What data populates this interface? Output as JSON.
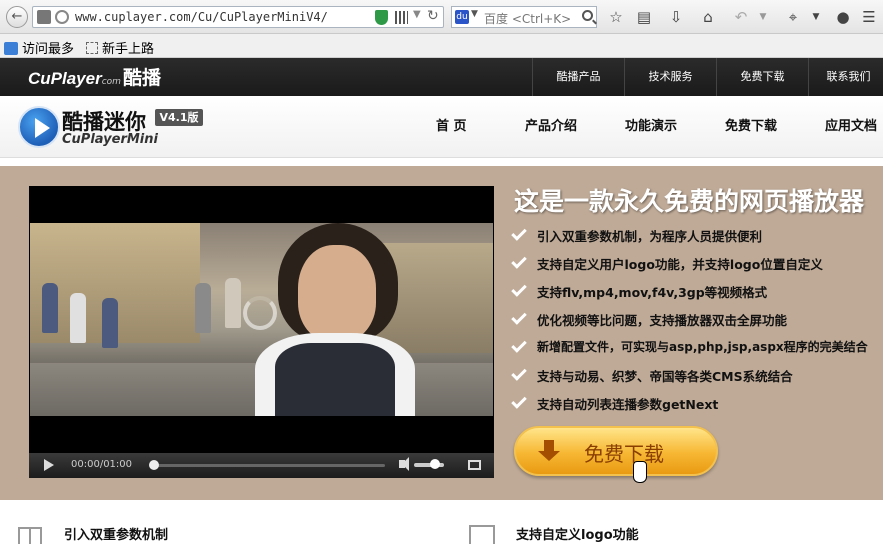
{
  "browser": {
    "url": "www.cuplayer.com/Cu/CuPlayerMiniV4/",
    "search_placeholder": "百度 <Ctrl+K>",
    "bookmarks": [
      "访问最多",
      "新手上路"
    ]
  },
  "site": {
    "logo_small": {
      "en": "CuPlayer",
      "com": "com",
      "cn": "酷播"
    },
    "top_nav": [
      "酷播产品",
      "技术服务",
      "免费下载",
      "联系我们"
    ],
    "brand": {
      "cn": "酷播迷你",
      "en": "CuPlayerMini",
      "version": "V4.1版"
    },
    "main_nav": [
      "首 页",
      "产品介绍",
      "功能演示",
      "免费下载",
      "应用文档"
    ]
  },
  "player": {
    "time": "00:00/01:00",
    "progress": 0.0,
    "volume": 0.6
  },
  "hero": {
    "title": "这是一款永久免费的网页播放器",
    "features": [
      "引入双重参数机制，为程序人员提供便利",
      "支持自定义用户logo功能，并支持logo位置自定义",
      "支持flv,mp4,mov,f4v,3gp等视频格式",
      "优化视频等比问题，支持播放器双击全屏功能",
      "新增配置文件，可实现与asp,php,jsp,aspx程序的完美结合",
      "支持与动易、织梦、帝国等各类CMS系统结合",
      "支持自动列表连播参数getNext"
    ],
    "download_label": "免费下载"
  },
  "bottom": {
    "items": [
      "引入双重参数机制",
      "支持自定义logo功能"
    ]
  },
  "colors": {
    "hero_bg": "#bfaa97",
    "topbar_bg": "#1f1f1f",
    "button_orange": "#f7b733"
  }
}
